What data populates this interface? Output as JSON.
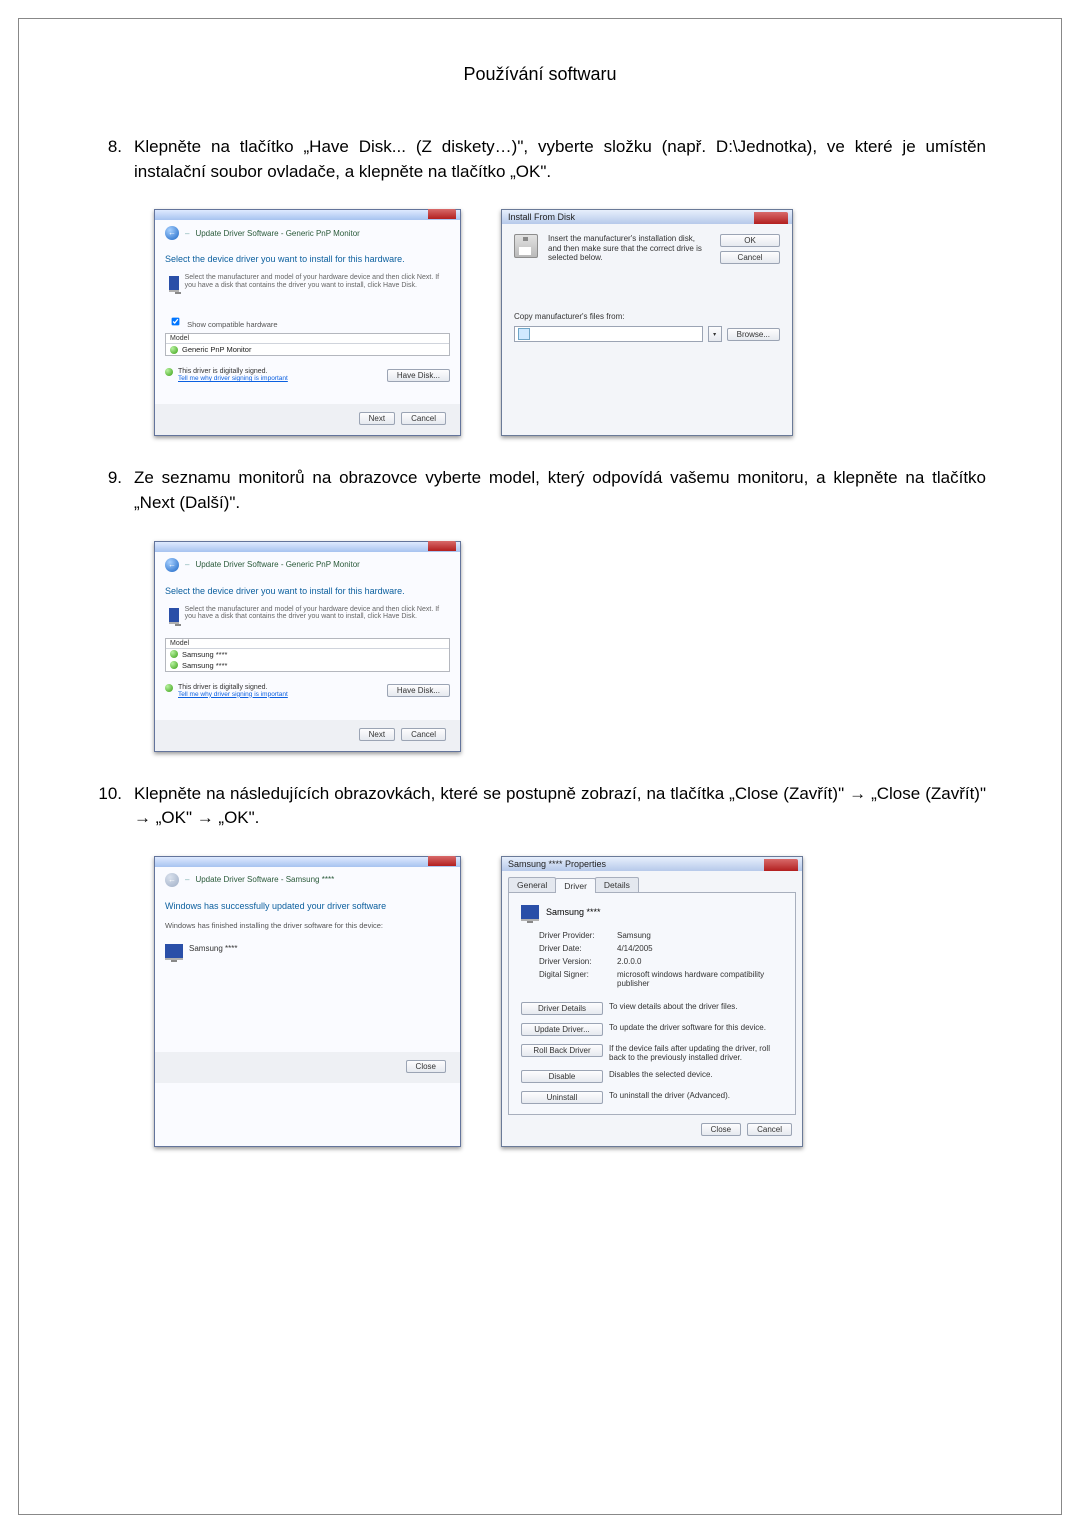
{
  "page_header": "Používání softwaru",
  "steps": {
    "s8": {
      "num": "8.",
      "text": "Klepněte na tlačítko „Have Disk... (Z diskety…)\", vyberte složku (např. D:\\Jednotka), ve které je umístěn instalační soubor ovladače, a klepněte na tlačítko „OK\"."
    },
    "s9": {
      "num": "9.",
      "text": "Ze seznamu monitorů na obrazovce vyberte model, který odpovídá vašemu monitoru, a klepněte na tlačítko „Next (Další)\"."
    },
    "s10": {
      "num": "10.",
      "text": "Klepněte na následujících obrazovkách, které se postupně zobrazí, na tlačítka „Close (Zavřít)\" → „Close (Zavřít)\" → „OK\" → „OK\"."
    }
  },
  "wiz": {
    "nav_generic": "Update Driver Software - Generic PnP Monitor",
    "nav_samsung": "Update Driver Software - Samsung ****",
    "heading_select": "Select the device driver you want to install for this hardware.",
    "heading_success": "Windows has successfully updated your driver software",
    "infotext": "Select the manufacturer and model of your hardware device and then click Next. If you have a disk that contains the driver you want to install, click Have Disk.",
    "show_compat": "Show compatible hardware",
    "model_header": "Model",
    "model_generic": "Generic PnP Monitor",
    "model_s1": "Samsung ****",
    "model_s2": "Samsung ****",
    "signed": "This driver is digitally signed.",
    "tellme": "Tell me why driver signing is important",
    "have_disk": "Have Disk...",
    "next": "Next",
    "cancel": "Cancel",
    "close": "Close",
    "finished_text": "Windows has finished installing the driver software for this device:",
    "finished_device": "Samsung ****"
  },
  "disk": {
    "title": "Install From Disk",
    "msg": "Insert the manufacturer's installation disk, and then make sure that the correct drive is selected below.",
    "ok": "OK",
    "cancel": "Cancel",
    "copy_label": "Copy manufacturer's files from:",
    "browse": "Browse..."
  },
  "prop": {
    "title": "Samsung **** Properties",
    "tab_general": "General",
    "tab_driver": "Driver",
    "tab_details": "Details",
    "device": "Samsung ****",
    "k_provider": "Driver Provider:",
    "v_provider": "Samsung",
    "k_date": "Driver Date:",
    "v_date": "4/14/2005",
    "k_version": "Driver Version:",
    "v_version": "2.0.0.0",
    "k_signer": "Digital Signer:",
    "v_signer": "microsoft windows hardware compatibility publisher",
    "btn_details": "Driver Details",
    "txt_details": "To view details about the driver files.",
    "btn_update": "Update Driver...",
    "txt_update": "To update the driver software for this device.",
    "btn_roll": "Roll Back Driver",
    "txt_roll": "If the device fails after updating the driver, roll back to the previously installed driver.",
    "btn_disable": "Disable",
    "txt_disable": "Disables the selected device.",
    "btn_uninstall": "Uninstall",
    "txt_uninstall": "To uninstall the driver (Advanced).",
    "close": "Close",
    "cancel": "Cancel"
  }
}
